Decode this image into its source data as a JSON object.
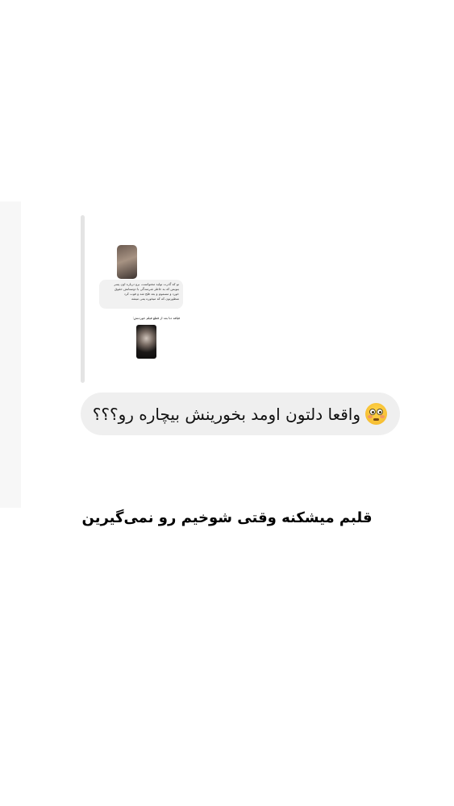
{
  "reply_preview": {
    "comment_lines": [
      "تو که گذرت تولید محتواست، برو درباره اون پسر",
      "بنویس که به خاطر شرمندگی با دوستانش حقوق",
      "خورد و مسموم و بعد فلج شد و فوت کرد"
    ],
    "comment_last_line": "منظورتون که که میخوره یمی میشه",
    "caption": "قیافه دنا بعد از قطع فیلم خوردنش:"
  },
  "question": {
    "text": "واقعا دلتون اومد بخورینش بیچاره رو؟؟؟",
    "emoji": "flushed-face"
  },
  "caption": {
    "text": "قلبم میشکنه وقتی شوخیم رو نمی‌گیرین"
  }
}
